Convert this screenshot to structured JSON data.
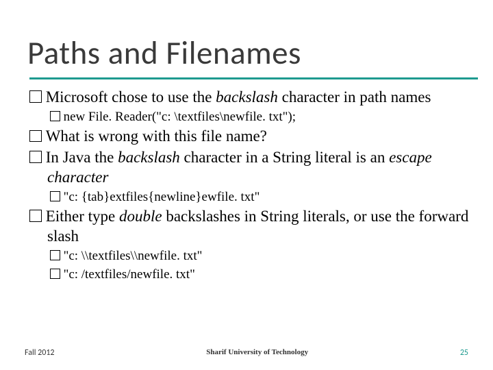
{
  "title": "Paths and Filenames",
  "bullets": {
    "b1_a": "Microsoft chose to use the ",
    "b1_i": "backslash",
    "b1_b": " character in path names",
    "b1_1": "new File. Reader(\"c: \\textfiles\\newfile. txt\");",
    "b2": "What is wrong with this file name?",
    "b3_a": "In Java the ",
    "b3_i1": "backslash",
    "b3_b": " character in a String literal is an ",
    "b3_i2": "escape character",
    "b3_1": "\"c: {tab}extfiles{newline}ewfile. txt\"",
    "b4_a": "Either type ",
    "b4_i": "double",
    "b4_b": " backslashes in String literals, or use the forward slash",
    "b4_1": "\"c: \\\\textfiles\\\\newfile. txt\"",
    "b4_2": "\"c: /textfiles/newfile. txt\""
  },
  "footer": {
    "left": "Fall 2012",
    "center": "Sharif University of Technology",
    "right": "25"
  }
}
